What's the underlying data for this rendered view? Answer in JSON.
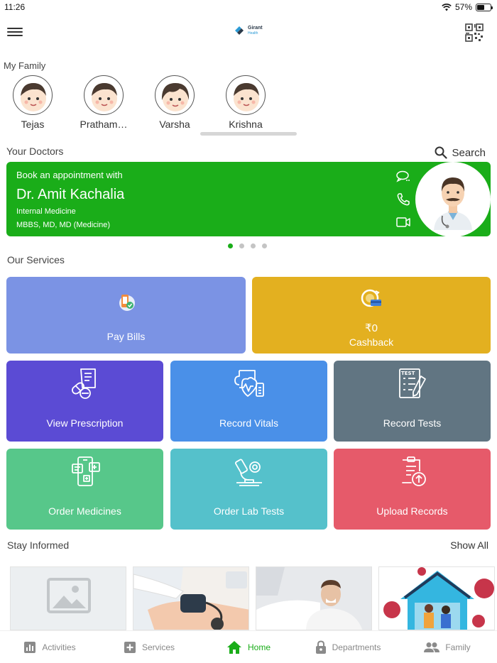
{
  "status": {
    "time": "11:26",
    "battery": "57%",
    "battery_level": 0.57
  },
  "header": {
    "logo_name": "Girant",
    "logo_sub": "Health"
  },
  "family": {
    "label": "My Family",
    "members": [
      {
        "name": "Tejas"
      },
      {
        "name": "Pratham…"
      },
      {
        "name": "Varsha"
      },
      {
        "name": "Krishna"
      }
    ]
  },
  "doctors": {
    "label": "Your Doctors",
    "search_label": "Search",
    "card": {
      "prefix": "Book an appointment with",
      "name": "Dr. Amit Kachalia",
      "specialty": "Internal Medicine",
      "degrees": "MBBS, MD, MD (Medicine)"
    },
    "carousel_pages": 4,
    "active_page": 1
  },
  "services": {
    "label": "Our Services",
    "pay_bills": "Pay Bills",
    "cashback_amount": "₹0",
    "cashback": "Cashback",
    "view_prescription": "View Prescription",
    "record_vitals": "Record Vitals",
    "record_tests": "Record Tests",
    "order_medicines": "Order Medicines",
    "order_lab_tests": "Order Lab Tests",
    "upload_records": "Upload Records",
    "test_icon_text": "TEST"
  },
  "informed": {
    "label": "Stay Informed",
    "show_all": "Show All"
  },
  "nav": {
    "activities": "Activities",
    "services": "Services",
    "home": "Home",
    "departments": "Departments",
    "family": "Family"
  },
  "colors": {
    "accent_green": "#1aad19",
    "pay_bills": "#7b93e4",
    "cashback": "#e3b020",
    "view_prescription": "#5b4bd4",
    "record_vitals": "#4a90e8",
    "record_tests": "#617582",
    "order_medicines": "#57c78a",
    "order_lab_tests": "#55c1cb",
    "upload_records": "#e65a6a"
  }
}
